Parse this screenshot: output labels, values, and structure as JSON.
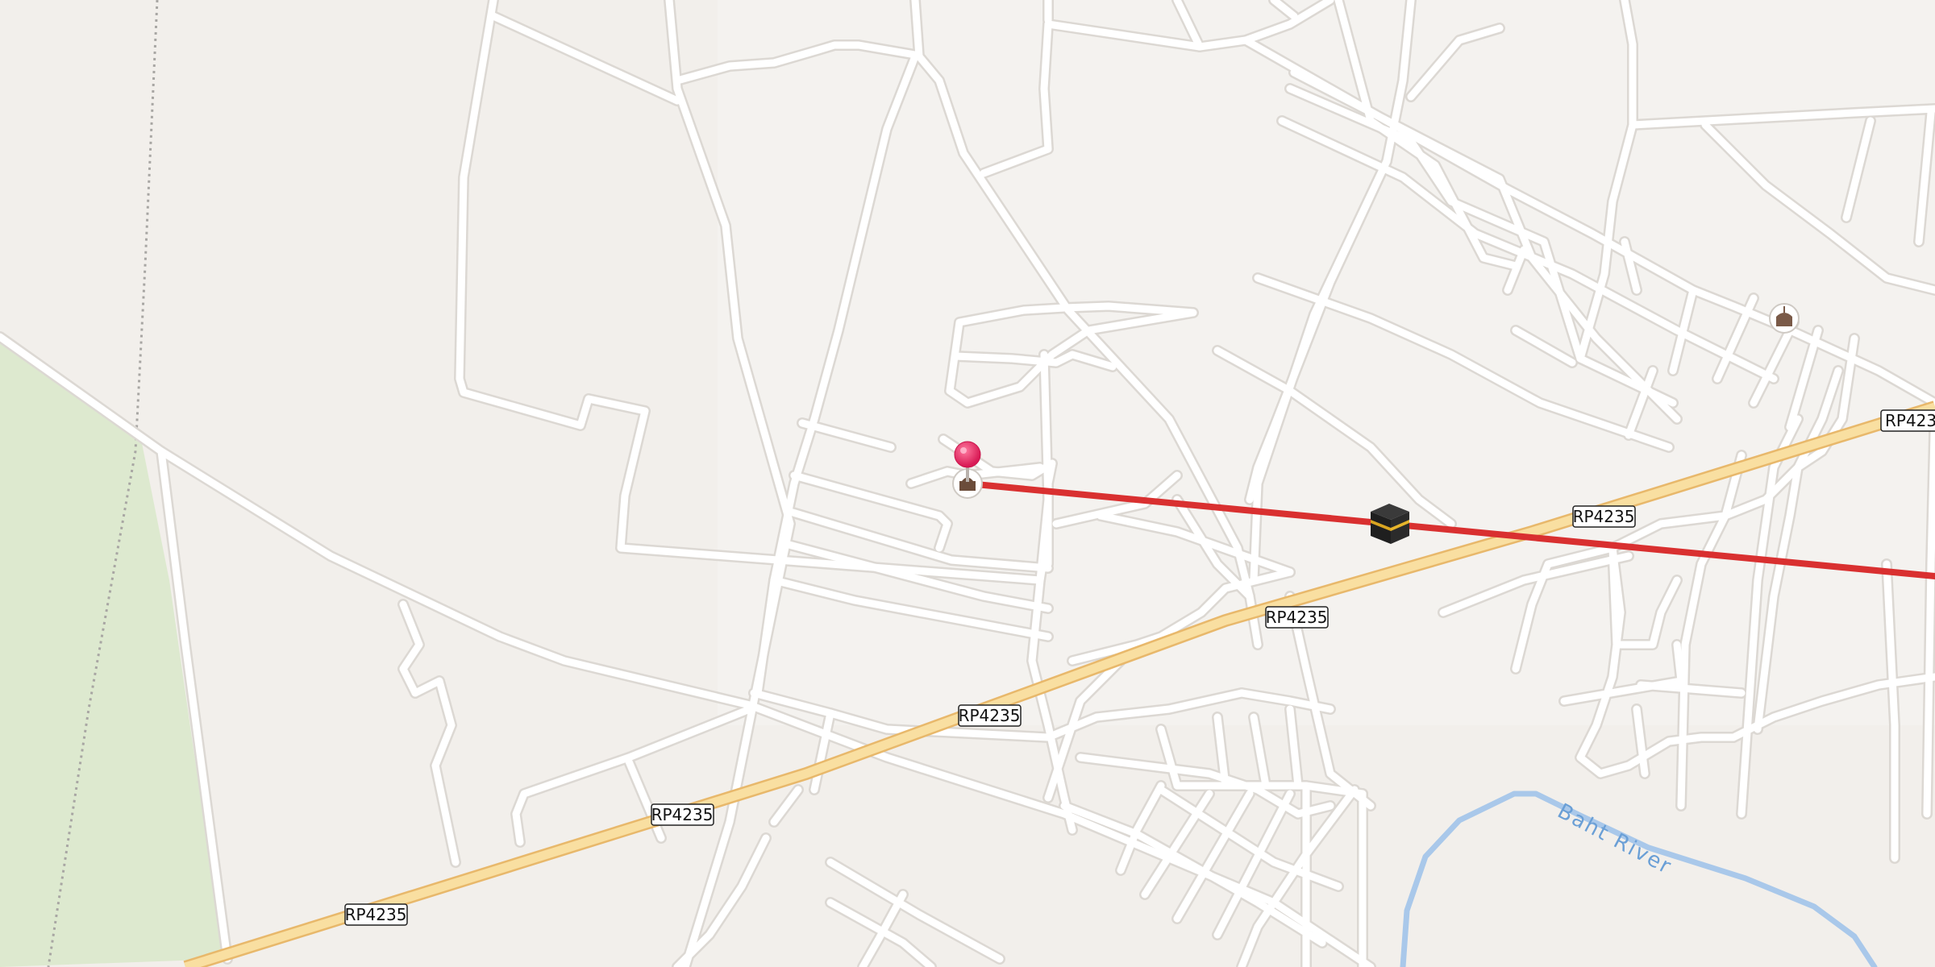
{
  "map": {
    "road_labels": [
      "RP4235",
      "RP4235",
      "RP4235",
      "RP4235",
      "RP4235",
      "RP4235"
    ],
    "road_label_clipped": "RP4235",
    "river_label": "Baht River",
    "colors": {
      "background": "#f2efeb",
      "park": "#dde9cf",
      "street": "#ffffff",
      "street_casing": "#dcd8d3",
      "highway_fill": "#f9dfa1",
      "highway_casing": "#e8b86b",
      "river": "#a9c8ea",
      "route_line": "#d93030",
      "marker": "#e8336d"
    },
    "icons": {
      "origin_marker": "map-pin-icon",
      "origin_poi": "mosque-icon",
      "destination": "kaaba-icon",
      "poi_east": "mosque-icon"
    }
  }
}
